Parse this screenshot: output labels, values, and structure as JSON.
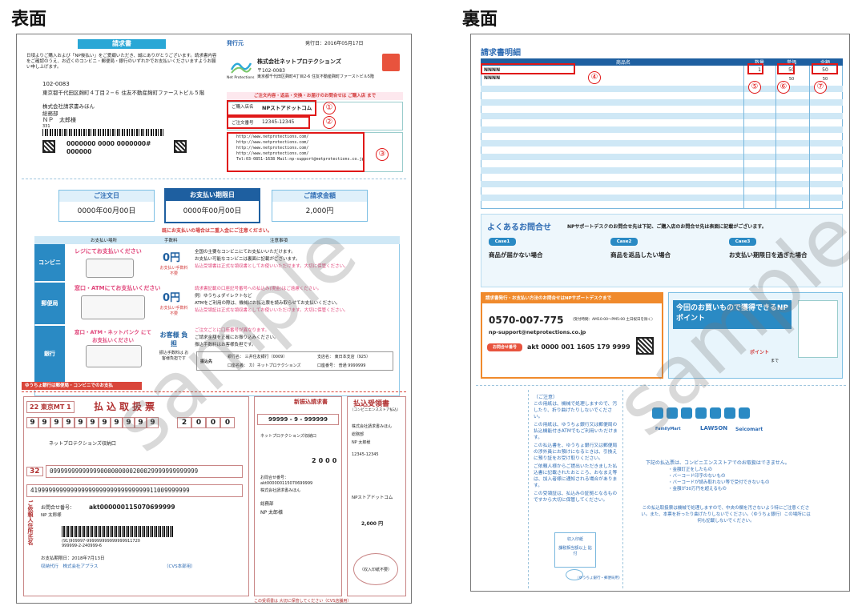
{
  "headings": {
    "front": "表面",
    "back": "裏面"
  },
  "front": {
    "title": "請求書",
    "issuer_label": "発行元",
    "issue_date": "発行日：2016年05月17日",
    "company_name": "株式会社ネットプロテクションズ",
    "postal": "〒102-0083",
    "company_address": "東京都千代田区麹町4丁目2-6 住友不動産麹町ファーストビル5階",
    "logo_caption": "Net Protections",
    "intro": "日頃よりご購入および「NP後払い」をご愛顧いただき、誠にありがとうございます。請求書内容をご確認のうえ、お近くのコンビニ・郵便局・銀行のいずれかでお支払いくださいますようお願い申し上げます。",
    "recipient_postal": "102-0083",
    "recipient_address": "東京都千代田区麹町４丁目２−６ 住友不動産麹町ファーストビル５階",
    "recipient_company": "株式会社請求書みほん",
    "recipient_dept": "総務部",
    "recipient_name": "ＮＰ　太郎様",
    "recipient_code": "331",
    "barcode_number_line1": "0000000  0000  0000000#",
    "barcode_number_line2": "000000",
    "inquiry_note": "ご注文内容・返品・交換・お届けのお問合せは ご購入店 まで",
    "shop_label": "ご購入店名",
    "shop_value": "NPストアドットコム",
    "order_label": "ご注文番号",
    "order_value": "12345-12345",
    "urls": [
      "http://www.netprotections.com/",
      "http://www.netprotections.com/",
      "http://www.netprotections.com/",
      "http://www.netprotections.com/",
      "Tel:03-0851-1638 Mail:np-support@netprotections.co.jp"
    ],
    "summary": {
      "order_date_label": "ご注文日",
      "order_date_value": "0000年00月00日",
      "due_label": "お支払い期限日",
      "due_value": "0000年00月00日",
      "amount_label": "ご請求金額",
      "amount_value": "2,000円"
    },
    "payment_note": "既にお支払いの場合は二重入金にご注意ください。",
    "pay_headers": [
      "お支払い場所",
      "手数料",
      "注意事項"
    ],
    "pay_rows": [
      {
        "place": "コンビニ",
        "title": "レジにてお支払いください",
        "fee": "0円",
        "fee_sub": "お支払い手数料 不要",
        "notes": [
          "全国の主要なコンビニにてお支払いいただけます。",
          "お支払い可能なコンビニは裏面に記載がございます。",
          "払込受領書は正式な領収書としてお使いいただけます。大切に保管ください。"
        ]
      },
      {
        "place": "郵便局",
        "title": "窓口・ATMにてお支払いください",
        "fee": "0円",
        "fee_sub": "お支払い手数料 不要",
        "notes": [
          "請求書記載の口座記号番号への払込み(現金)はご遠慮ください。",
          "例）ゆうちょダイレクトなど",
          "ATMをご利用の際は、機械にお払込票を読み取らせてお支払いください。",
          "払込受領証は正式な領収書としてお使いいただけます。大切に保管ください。"
        ]
      },
      {
        "place": "銀行",
        "title": "窓口・ATM・ネットバンク にてお支払いください",
        "fee": "お客様 負担",
        "fee_sub": "振込手数料は お客様負担です",
        "notes": [
          "ご注文ごとに口座番号が異なります。",
          "ご請求金額を正確にお振り込みください。",
          "振込手数料はお客様負担です。"
        ]
      }
    ],
    "bank_info": {
      "label": "振込先",
      "bank": "銀行名： 三井住友銀行（0009）",
      "branch": "支店名： 東日本支店（925）",
      "holder": "口座名義： カ）ネットプロテクションズ",
      "account": "口座番号： 普通 9999999"
    },
    "stub_bar": "ゆうちょ銀行は郵便局・コンビニでのお支払",
    "stub": {
      "title": "払込取扱票",
      "code1": "22 東京MT 1",
      "account_digits": [
        "9",
        "9",
        "9",
        "9",
        "9",
        "9",
        "9",
        "9",
        "9",
        "9",
        "9"
      ],
      "amount_digits": [
        "2",
        "0",
        "0",
        "0"
      ],
      "payee": "ネットプロテクションズ収納口",
      "code2": "32",
      "long1": "09999999999999000000000200029999999999999",
      "long2": "41999999999999999999999999999999911009999999",
      "number_label": "お問合せ番号：",
      "number_value": "akt000000115070699999",
      "np_taro": "NP 太郎様",
      "stub_barcode_num": "(91)909997-999999999999999911720",
      "stub_barcode_num2": "999999-2-240999-6",
      "print_date": "お支払期限日：2018年7月13日",
      "agent": "収納代行　株式会社アプラス",
      "cvs": "（CVS本部用）",
      "side": "ご依頼人住所氏名",
      "receipt_title": "払込受領書",
      "receipt_sub": "（コンビニエンスストア払込）",
      "new_receipt": "新振込請求書",
      "receipt_digits": "99999 - 9 - 999999",
      "receipt_payee": "ネットプロテクションズ収納口",
      "receipt_amount": "2000",
      "receipt_company": "株式会社請求書みほん",
      "receipt_dept": "総務部",
      "receipt_name": "NP 太郎様",
      "receipt_shop": "NPストアドットコム",
      "receipt_total": "2,000 円",
      "receipt_order": "12345-12345",
      "receipt_stamp": "（収入印紙不要）",
      "receipt_footer": "この受領書は 大切に保管してください（CVS店舗用）"
    }
  },
  "back": {
    "title": "請求書明細",
    "col_item": "商品名",
    "col_qty": "数量",
    "col_price": "単価",
    "col_total": "金額",
    "rows": [
      {
        "item": "NNNN",
        "qty": "1",
        "price": "50",
        "total": "50"
      },
      {
        "item": "NNNN",
        "qty": "",
        "price": "50",
        "total": "50"
      }
    ],
    "faq_title": "よくあるお問合せ",
    "faq_sub": "NPサポートデスクのお問合せ先は下記、ご購入店のお問合せ先は表面に記載がございます。",
    "cases": [
      {
        "tag": "Case1",
        "text": "商品が届かない場合"
      },
      {
        "tag": "Case2",
        "text": "商品を返品したい場合"
      },
      {
        "tag": "Case3",
        "text": "お支払い期限日を過ぎた場合"
      }
    ],
    "support_title": "請求書発行・お支払い方法のお問合せはNPサポートデスクまで",
    "support_tel": "0570-007-775",
    "support_hours": "（受付時間：AM10:00〜PM5:00 土日祝日を除く）",
    "support_mail": "np-support@netprotections.co.jp",
    "support_number_label": "お問合せ番号",
    "support_number": "akt 0000 001 1605 179 9999",
    "point_title": "今回のお買いもので獲得できるNPポイント",
    "point_label": "ポイント",
    "point_until": "まで",
    "stores": [
      "FamilyMart",
      "LAWSON",
      "Seicomart"
    ],
    "cvs_note_title": "下記の払込票は、コンビニエンスストアでのお取扱はできません。",
    "cvs_notes": [
      "・金額訂正をしたもの",
      "・バーコード印字のないもの",
      "・バーコードが読み取れない等で受付できないもの",
      "・金額が30万円を超えるもの"
    ],
    "cvs_footer": "この払込取扱票は機械で処理しますので、中央の欄を汚さないよう特にご注意ください。また、本票を折ったり曲げたりしないでください。（ゆうちょ銀行）この場所には何も記載しないでください。",
    "notice_title": "（ご注意）",
    "notices": [
      "この用紙は、機械で処理しますので、汚したり、折り曲げたりしないでください。",
      "この用紙は、ゆうちょ銀行又は郵便局の払込機能付きATMでもご利用いただけます。",
      "この払込書を、ゆうちょ銀行又は郵便局の渉外員にお預けになるときは、引換えに預り証をお受け取りください。",
      "ご依頼人様からご提出いただきました払込書に記載されたおところ、おなまえ等は、加入者様に通知される場合があります。",
      "この受領証は、払込みの証拠となるものですから大切に保管してください。"
    ],
    "stamp_label": "収入印紙",
    "stamp_sub": "課税相当額以上 貼　付",
    "stamp_footer": "（ゆうちょ銀行・郵便局用）"
  },
  "markers": [
    "①",
    "②",
    "③",
    "④",
    "⑤",
    "⑥",
    "⑦"
  ],
  "watermark": "sample"
}
